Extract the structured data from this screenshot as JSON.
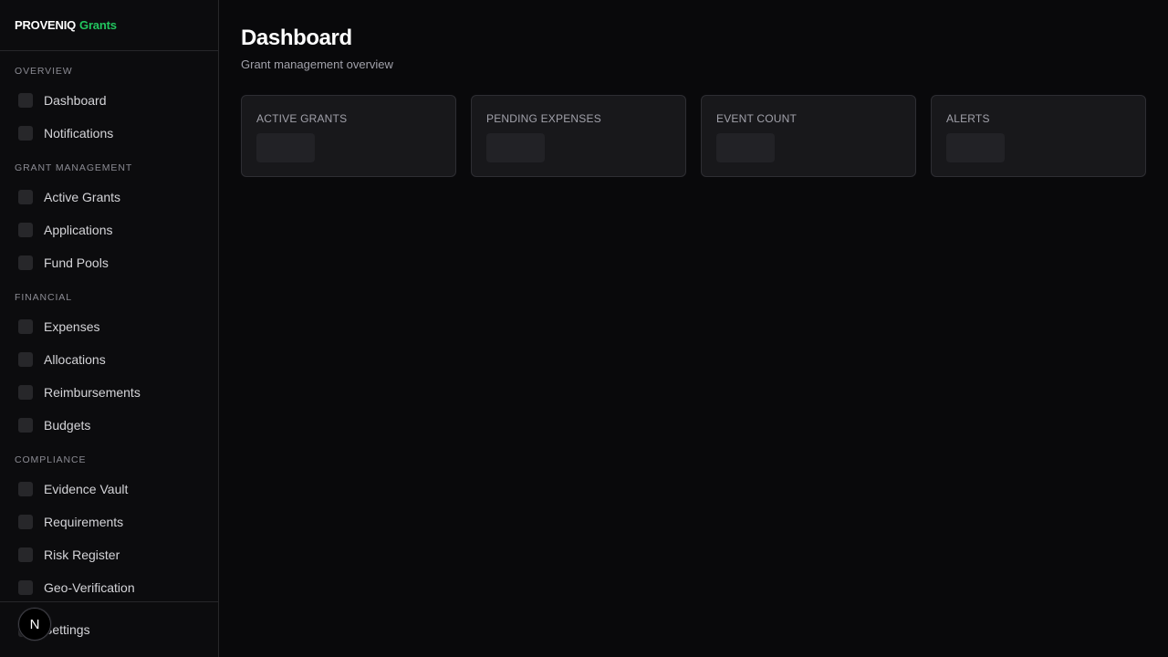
{
  "brand": {
    "name": "PROVENIQ",
    "accent": "Grants",
    "accent_color": "#22c55e"
  },
  "sidebar": {
    "sections": [
      {
        "label": "OVERVIEW",
        "items": [
          {
            "label": "Dashboard"
          },
          {
            "label": "Notifications"
          }
        ]
      },
      {
        "label": "GRANT MANAGEMENT",
        "items": [
          {
            "label": "Active Grants"
          },
          {
            "label": "Applications"
          },
          {
            "label": "Fund Pools"
          }
        ]
      },
      {
        "label": "FINANCIAL",
        "items": [
          {
            "label": "Expenses"
          },
          {
            "label": "Allocations"
          },
          {
            "label": "Reimbursements"
          },
          {
            "label": "Budgets"
          }
        ]
      },
      {
        "label": "COMPLIANCE",
        "items": [
          {
            "label": "Evidence Vault"
          },
          {
            "label": "Requirements"
          },
          {
            "label": "Risk Register"
          },
          {
            "label": "Geo-Verification"
          }
        ]
      }
    ],
    "footer": {
      "label": "Settings",
      "badge": "N"
    }
  },
  "main": {
    "title": "Dashboard",
    "subtitle": "Grant management overview",
    "cards": [
      {
        "label": "ACTIVE GRANTS"
      },
      {
        "label": "PENDING EXPENSES"
      },
      {
        "label": "EVENT COUNT"
      },
      {
        "label": "ALERTS"
      }
    ]
  }
}
